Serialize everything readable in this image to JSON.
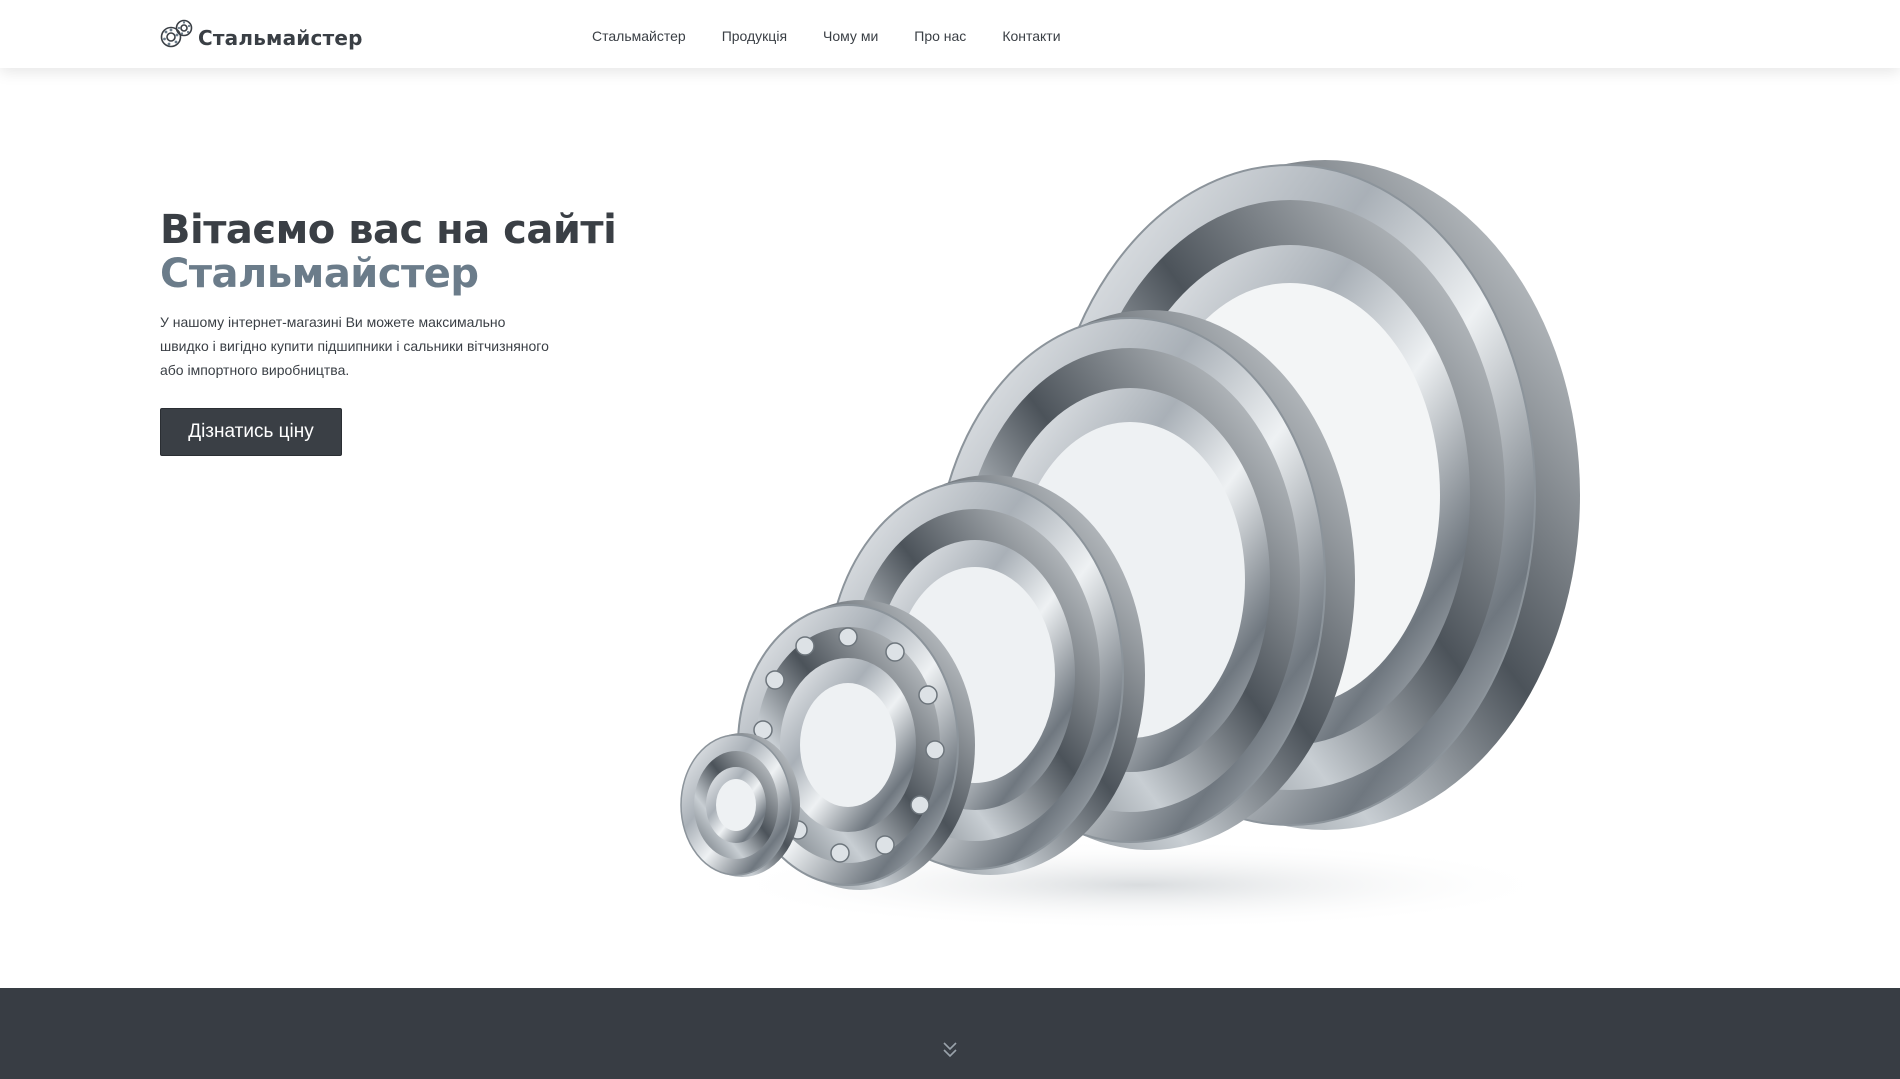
{
  "header": {
    "logo_text": "Стальмайстер",
    "logo_icon": "bearing-gears-icon",
    "nav": [
      {
        "label": "Стальмайстер"
      },
      {
        "label": "Продукція"
      },
      {
        "label": "Чому ми"
      },
      {
        "label": "Про нас"
      },
      {
        "label": "Контакти"
      }
    ]
  },
  "hero": {
    "title_line1": "Вітаємо вас на сайті",
    "title_line2": "Стальмайстер",
    "description": "У нашому інтернет-магазині Ви можете максимально швидко і вигідно купити підшипники і сальники вітчизняного або імпортного виробництва.",
    "cta_label": "Дізнатись ціну",
    "image": "ball-bearings-image"
  },
  "footer": {
    "scroll_icon": "chevron-double-down-icon"
  },
  "colors": {
    "text": "#3a3f45",
    "accent": "#6b7c8a",
    "button_bg": "#3a3f45",
    "band_bg": "#383d44"
  }
}
